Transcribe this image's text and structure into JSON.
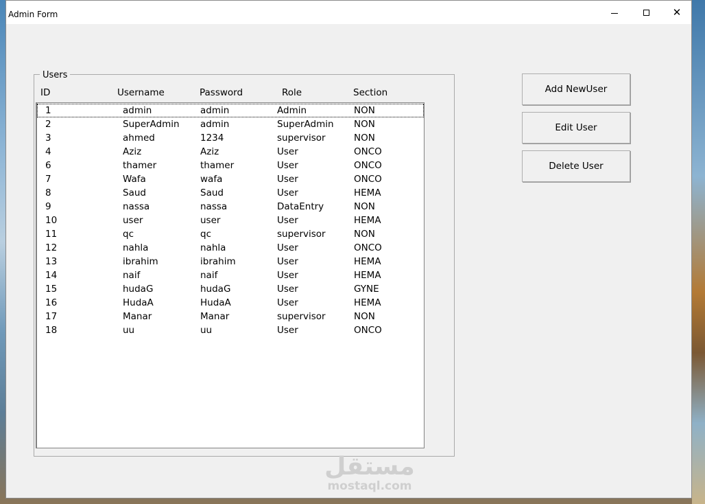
{
  "window": {
    "title": "Admin Form",
    "close_glyph": "✕"
  },
  "users_group": {
    "label": "Users",
    "columns": [
      "ID",
      "Username",
      "Password",
      "Role",
      "Section"
    ],
    "rows": [
      {
        "id": "1",
        "username": "admin",
        "password": "admin",
        "role": "Admin",
        "section": "NON"
      },
      {
        "id": "2",
        "username": "SuperAdmin",
        "password": "admin",
        "role": "SuperAdmin",
        "section": "NON"
      },
      {
        "id": "3",
        "username": "ahmed",
        "password": "1234",
        "role": "supervisor",
        "section": "NON"
      },
      {
        "id": "4",
        "username": "Aziz",
        "password": "Aziz",
        "role": "User",
        "section": "ONCO"
      },
      {
        "id": "6",
        "username": "thamer",
        "password": "thamer",
        "role": "User",
        "section": "ONCO"
      },
      {
        "id": "7",
        "username": "Wafa",
        "password": "wafa",
        "role": "User",
        "section": "ONCO"
      },
      {
        "id": "8",
        "username": "Saud",
        "password": "Saud",
        "role": "User",
        "section": "HEMA"
      },
      {
        "id": "9",
        "username": "nassa",
        "password": "nassa",
        "role": "DataEntry",
        "section": "NON"
      },
      {
        "id": "10",
        "username": "user",
        "password": "user",
        "role": "User",
        "section": "HEMA"
      },
      {
        "id": "11",
        "username": "qc",
        "password": "qc",
        "role": "supervisor",
        "section": "NON"
      },
      {
        "id": "12",
        "username": "nahla",
        "password": "nahla",
        "role": "User",
        "section": "ONCO"
      },
      {
        "id": "13",
        "username": "ibrahim",
        "password": "ibrahim",
        "role": "User",
        "section": "HEMA"
      },
      {
        "id": "14",
        "username": "naif",
        "password": "naif",
        "role": "User",
        "section": "HEMA"
      },
      {
        "id": "15",
        "username": "hudaG",
        "password": "hudaG",
        "role": "User",
        "section": "GYNE"
      },
      {
        "id": "16",
        "username": "HudaA",
        "password": "HudaA",
        "role": "User",
        "section": "HEMA"
      },
      {
        "id": "17",
        "username": "Manar",
        "password": "Manar",
        "role": "supervisor",
        "section": "NON"
      },
      {
        "id": "18",
        "username": "uu",
        "password": "uu",
        "role": "User",
        "section": "ONCO"
      }
    ]
  },
  "buttons": {
    "add": "Add NewUser",
    "edit": "Edit User",
    "delete": "Delete User"
  },
  "watermark": {
    "logo": "مستقل",
    "site": "mostaql.com"
  }
}
